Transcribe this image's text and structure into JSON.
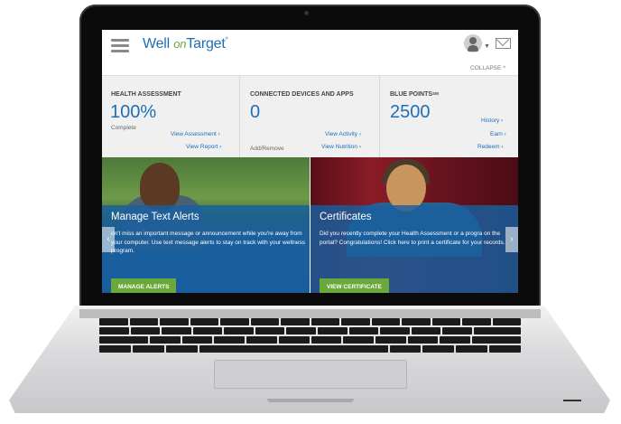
{
  "header": {
    "logo_left": "Well ",
    "logo_on": "on",
    "logo_right": "Target",
    "logo_mark": "®",
    "collapse_label": "COLLAPSE",
    "collapse_icon": "^"
  },
  "panels": {
    "health": {
      "title": "HEALTH ASSESSMENT",
      "value": "100%",
      "status": "Complete",
      "link1": "View Assessment",
      "link2": "View Report"
    },
    "devices": {
      "title": "CONNECTED DEVICES AND APPS",
      "value": "0",
      "link_add": "Add/Remove",
      "link1": "View Activity",
      "link2": "View Nutrition"
    },
    "points": {
      "title": "BLUE POINTS",
      "title_sup": "SM",
      "value": "2500",
      "link1": "History",
      "link2": "Earn",
      "link3": "Redeem"
    }
  },
  "banners": [
    {
      "title": "Manage Text Alerts",
      "text": "on't miss an important message or announcement while you're away from your computer. Use text message alerts to stay on track with your wellness program.",
      "button": "MANAGE ALERTS"
    },
    {
      "title": "Certificates",
      "text": "Did you recently complete your Health Assessment or a progra on the portal? Congratulations! Click here to print a certificate for your records.",
      "button": "VIEW CERTIFICATE"
    }
  ],
  "chevron": "›",
  "icons": [
    "menu-icon",
    "avatar-icon",
    "mail-icon",
    "chevron-left-icon",
    "chevron-right-icon"
  ],
  "colors": {
    "brand_blue": "#1f6eb6",
    "brand_green": "#6aa83c"
  }
}
